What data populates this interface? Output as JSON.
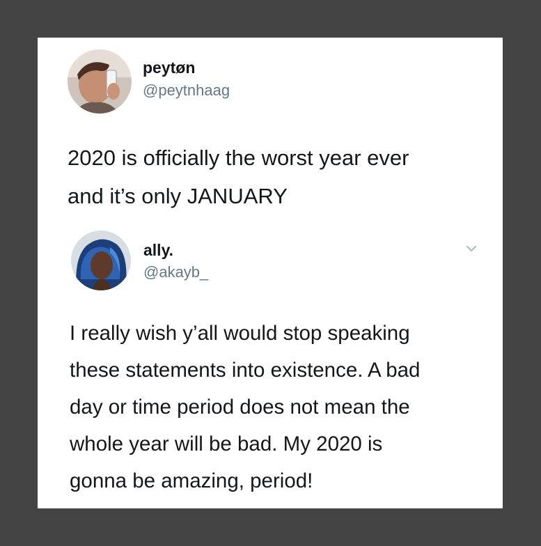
{
  "tweet": {
    "author_name": "peytøn",
    "author_handle": "@peytnhaag",
    "text_lines": [
      "2020 is officially the worst year ever",
      "and it’s only JANUARY"
    ]
  },
  "reply": {
    "author_name": "ally.",
    "author_handle": "@akayb_",
    "text_lines": [
      "I really wish y’all would stop speaking",
      "these statements into existence. A bad",
      "day or time period does not mean the",
      "whole year will be bad. My 2020 is",
      "gonna be amazing, period!"
    ],
    "menu_icon": "chevron-down-icon"
  },
  "colors": {
    "frame_background": "#444444",
    "card_background": "#ffffff",
    "text_primary": "#14171a",
    "text_secondary": "#657786",
    "chevron": "#aab8c2"
  }
}
